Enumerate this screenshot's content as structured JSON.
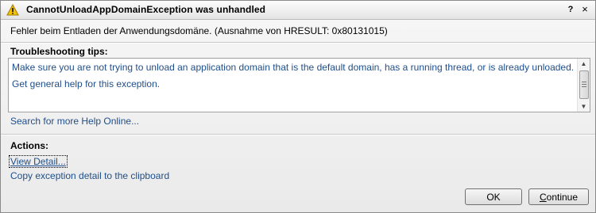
{
  "titlebar": {
    "title": "CannotUnloadAppDomainException was unhandled",
    "help_label": "?",
    "close_label": "×"
  },
  "message": "Fehler beim Entladen der Anwendungsdomäne. (Ausnahme von HRESULT: 0x80131015)",
  "troubleshooting": {
    "heading": "Troubleshooting tips:",
    "tips": [
      "Make sure you are not trying to unload an application domain that is the default domain, has a running thread, or is already unloaded.",
      "Get general help for this exception."
    ],
    "search_link": "Search for more Help Online..."
  },
  "actions": {
    "heading": "Actions:",
    "view_detail": "View Detail...",
    "copy_detail": "Copy exception detail to the clipboard"
  },
  "buttons": {
    "ok": "OK",
    "continue_mnemonic": "C",
    "continue_rest": "ontinue"
  },
  "colors": {
    "link": "#1e4e8c",
    "warning": "#f5c400"
  },
  "icons": {
    "title": "warning-icon",
    "scroll_up": "scroll-up-arrow-icon",
    "scroll_down": "scroll-down-arrow-icon"
  }
}
